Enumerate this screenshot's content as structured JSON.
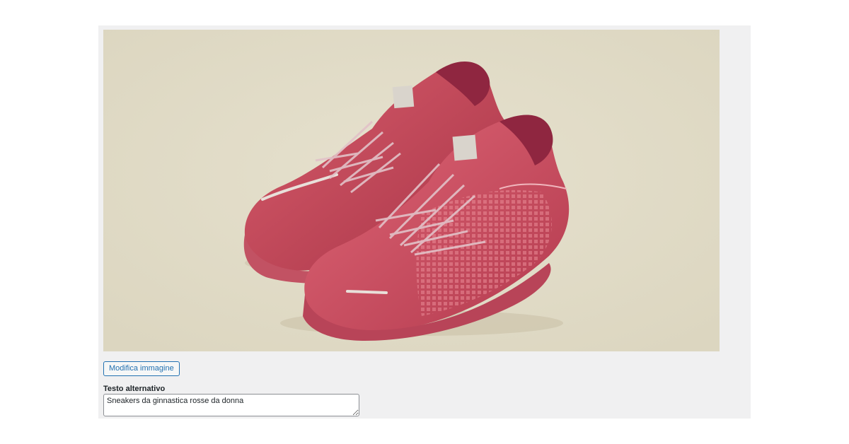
{
  "image": {
    "subject": "red sneakers photo",
    "background_color": "#e2dcc8"
  },
  "edit_button": {
    "label": "Modifica immagine"
  },
  "alt_text": {
    "label": "Testo alternativo",
    "value": "Sneakers da ginnastica rosse da donna"
  },
  "colors": {
    "panel_bg": "#f0f0f1",
    "accent": "#2271b1",
    "shoe_main": "#c9475a",
    "shoe_dark": "#9e2f45"
  }
}
